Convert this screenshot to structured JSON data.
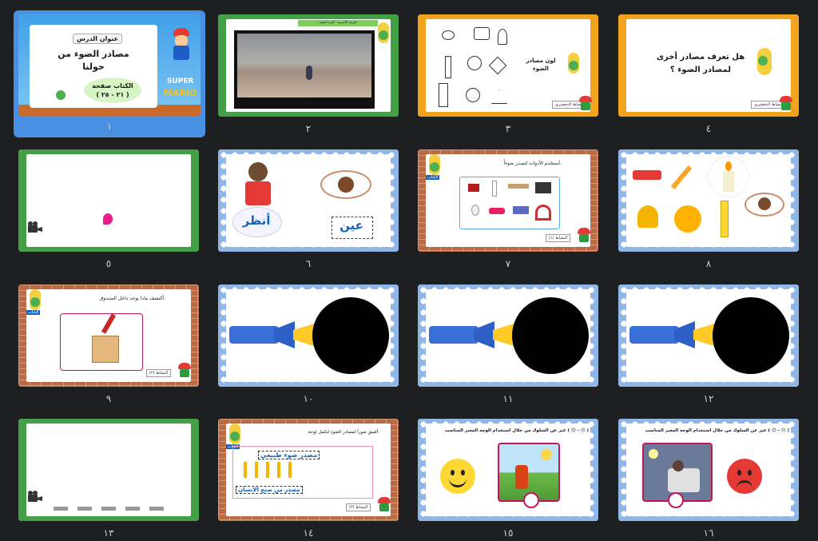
{
  "slides": [
    {
      "num": "١",
      "lesson_label": "عنوان الدرس",
      "title_line1": "مصادر الضوء من",
      "title_line2": "حولنا",
      "book_line1": "الكتاب صفحة",
      "book_line2": "( ٢١ - ٢٥ )",
      "brand_line1": "SUPER",
      "brand_line2": "MARIO"
    },
    {
      "num": "٢",
      "header": "التربية الأسرية - الجزء المجد"
    },
    {
      "num": "٣",
      "caption_line1": "لون مصادر",
      "caption_line2": "الضوء",
      "footer": "النشاط التحضيري"
    },
    {
      "num": "٤",
      "question_line1": "هل تعرف مصادر أخرى",
      "question_line2": "لمصادر الضوء ؟",
      "footer": "النشاط التحضيري"
    },
    {
      "num": "٥"
    },
    {
      "num": "٦",
      "word_look": "أنظر",
      "word_eye": "عين"
    },
    {
      "num": "٧",
      "instruction": "أستخدم الأدوات لتصدر ضوءاً.",
      "book_label": "الكتاب",
      "footer": "النشاط (١)"
    },
    {
      "num": "٨"
    },
    {
      "num": "٩",
      "instruction": "أكتشف ماذا يوجد داخل الصندوق.",
      "book_label": "الكتاب",
      "footer": "النشاط (٢)"
    },
    {
      "num": "١٠"
    },
    {
      "num": "١١"
    },
    {
      "num": "١٢"
    },
    {
      "num": "١٣"
    },
    {
      "num": "١٤",
      "instruction": "ألصق صوراً لمصادر الضوء لتكمل لوحة:",
      "book_label": "الكتاب",
      "natural": "مصدر ضوء طبيعي",
      "manmade": "مصدر من صنع الانسان",
      "footer": "النشاط (٣)"
    },
    {
      "num": "١٥",
      "instruction": "عبر عن السلوك من خلال استخدام الوجه المعبر المناسب ( 😊 - ☹ )"
    },
    {
      "num": "١٦",
      "instruction": "عبر عن السلوك من خلال استخدام الوجه المعبر المناسب ( 😊 - ☹ )"
    }
  ],
  "colors": {
    "background": "#1e1f21",
    "selection": "#4a90e2",
    "green_frame": "#43a047",
    "orange_frame": "#f2a31e",
    "blue_frame": "#8fb6e6"
  },
  "selected_slide": 1
}
